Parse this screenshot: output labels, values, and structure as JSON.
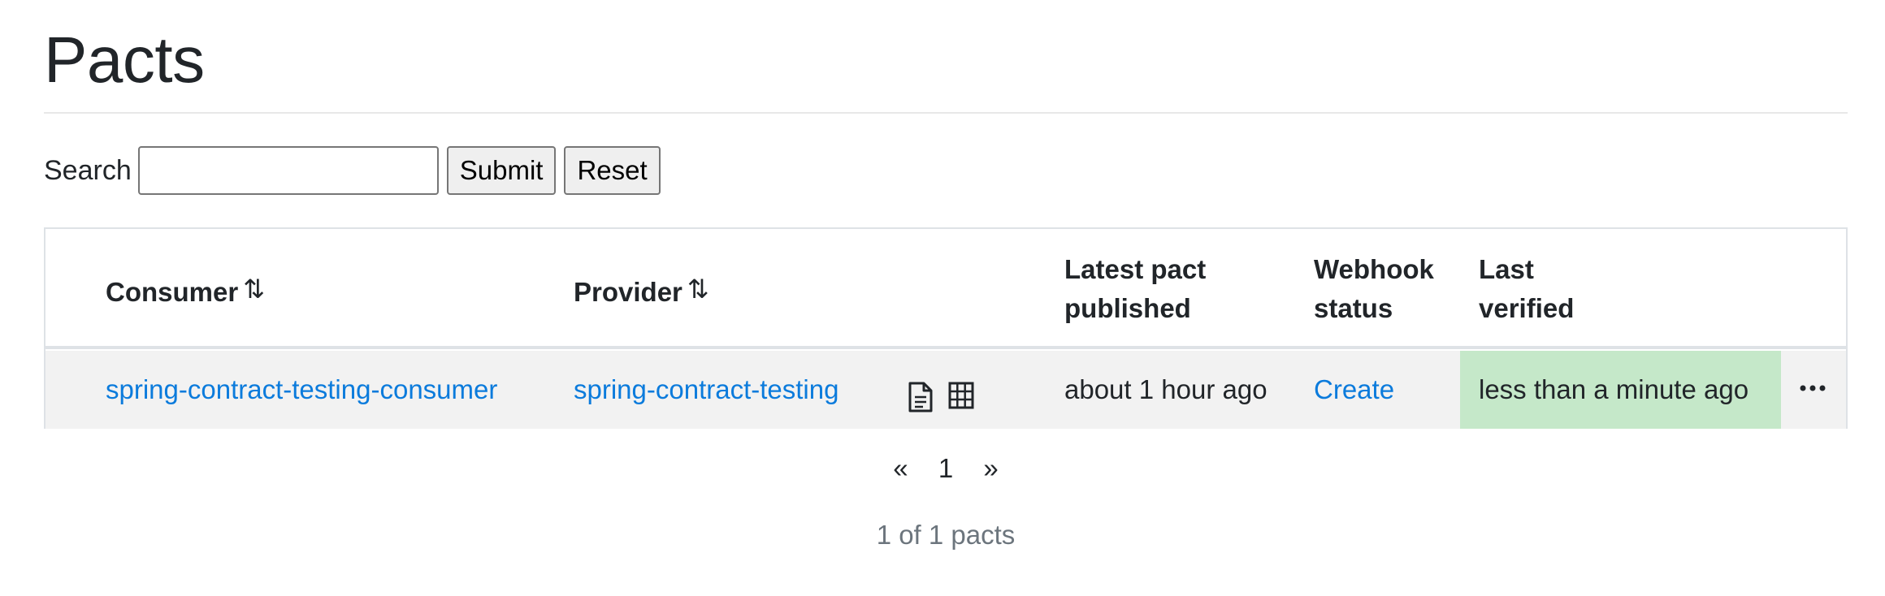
{
  "page": {
    "title": "Pacts"
  },
  "search": {
    "label": "Search",
    "value": "",
    "submit_label": "Submit",
    "reset_label": "Reset"
  },
  "table": {
    "headers": {
      "consumer": "Consumer",
      "provider": "Provider",
      "latest_pact_line1": "Latest pact",
      "latest_pact_line2": "published",
      "webhook_line1": "Webhook",
      "webhook_line2": "status",
      "verified_line1": "Last",
      "verified_line2": "verified"
    },
    "sort_icon": "⇅",
    "rows": [
      {
        "consumer": "spring-contract-testing-consumer",
        "provider": "spring-contract-testing",
        "latest_pact_published": "about 1 hour ago",
        "webhook_status": "Create",
        "last_verified": "less than a minute ago",
        "icons": [
          "document-icon",
          "matrix-table-icon"
        ]
      }
    ]
  },
  "pagination": {
    "prev": "«",
    "current": "1",
    "next": "»"
  },
  "summary": "1 of 1 pacts",
  "colors": {
    "link": "#0b7bdc",
    "verified_success": "#c5e8c9",
    "row_bg": "#f2f2f2"
  }
}
